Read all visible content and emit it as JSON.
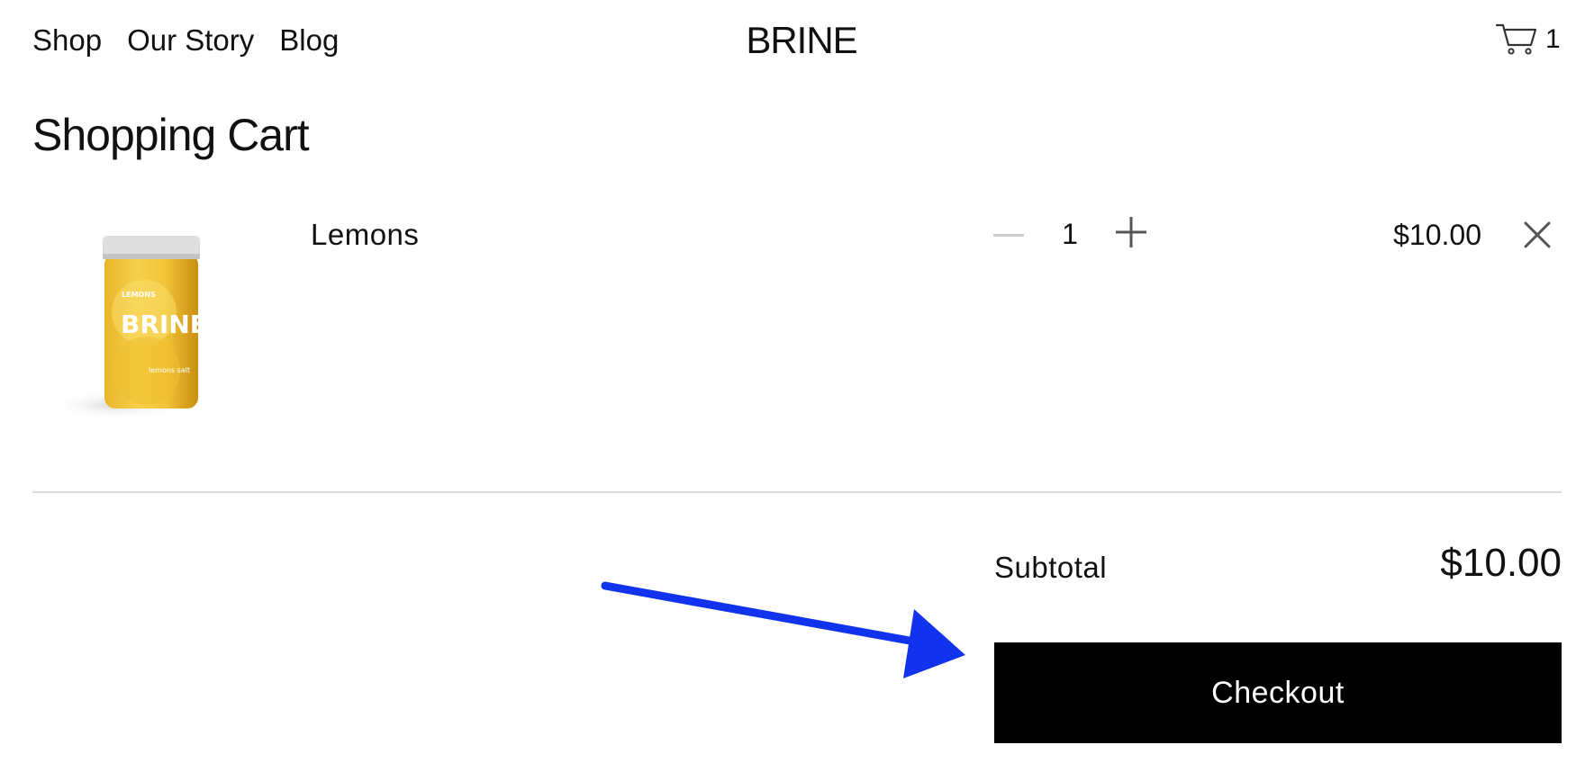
{
  "header": {
    "nav": [
      {
        "label": "Shop"
      },
      {
        "label": "Our Story"
      },
      {
        "label": "Blog"
      }
    ],
    "brand": "BRINE",
    "cart_icon": "shopping-cart-icon",
    "cart_count": "1"
  },
  "page_title": "Shopping Cart",
  "cart": {
    "items": [
      {
        "name": "Lemons",
        "image_icon": "lemons-jar-product-image",
        "jar_label_top": "LEMONS",
        "jar_label_brand": "BRINE",
        "jar_label_ingredients": "lemons salt",
        "quantity": "1",
        "price": "$10.00",
        "decrement_icon": "minus-icon",
        "increment_icon": "plus-icon",
        "remove_icon": "close-icon"
      }
    ]
  },
  "summary": {
    "subtotal_label": "Subtotal",
    "subtotal_value": "$10.00",
    "checkout_label": "Checkout"
  },
  "annotation": {
    "icon": "arrow-annotation",
    "color": "#1133ee"
  },
  "colors": {
    "text": "#111111",
    "button_bg": "#000000",
    "button_text": "#ffffff",
    "divider": "#dcdcdc",
    "disabled_control": "#d0d0d0",
    "control": "#555555"
  }
}
